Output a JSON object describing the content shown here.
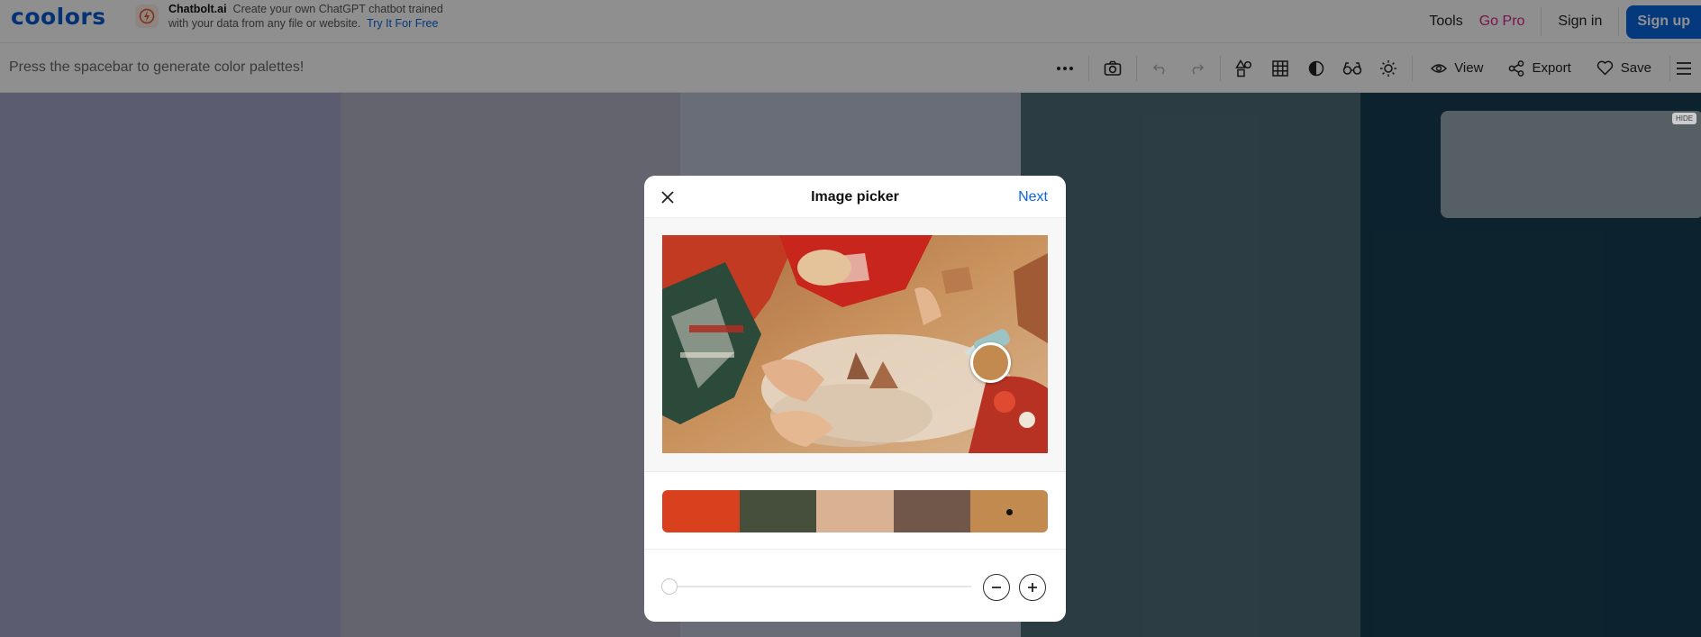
{
  "topbar": {
    "logo": "coolors",
    "ad": {
      "brand": "Chatbolt.ai",
      "line1": "Create your own ChatGPT chatbot trained",
      "line2": "with your data from any file or website.",
      "link": "Try It For Free"
    },
    "nav": {
      "tools": "Tools",
      "go_pro": "Go Pro",
      "sign_in": "Sign in",
      "sign_up": "Sign up"
    }
  },
  "toolbar": {
    "hint": "Press the spacebar to generate color palettes!",
    "view_label": "View",
    "export_label": "Export",
    "save_label": "Save"
  },
  "palette_columns": [
    "#a4a4c8",
    "#b2b2c6",
    "#b9c2d6",
    "#4e6e78",
    "#173e52"
  ],
  "side_card": {
    "hide_label": "HIDE"
  },
  "modal": {
    "title": "Image picker",
    "next_label": "Next",
    "picked_color": "#c38a50",
    "swatches": [
      "#d9401e",
      "#454f3c",
      "#d8b293",
      "#705749",
      "#c38a50"
    ],
    "selected_swatch": 4,
    "slider_value": 0
  }
}
